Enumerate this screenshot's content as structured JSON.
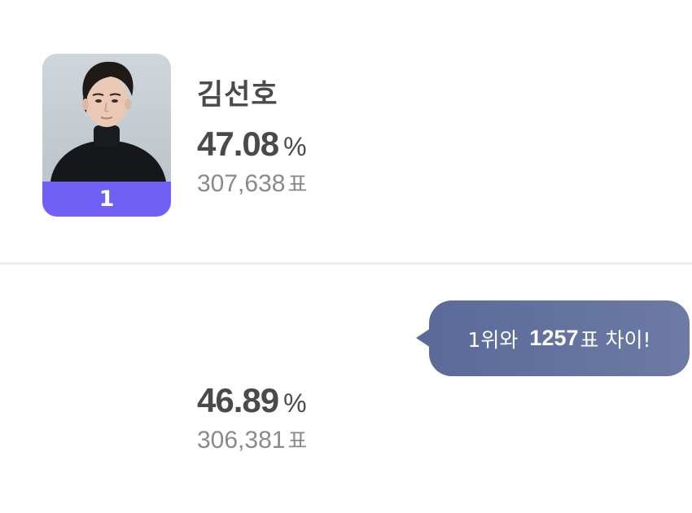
{
  "candidates": [
    {
      "rank": "1",
      "name": "김선호",
      "percent": "47.08",
      "percent_unit": "%",
      "votes": "307,638",
      "votes_unit": "표"
    },
    {
      "percent": "46.89",
      "percent_unit": "%",
      "votes": "306,381",
      "votes_unit": "표"
    }
  ],
  "gap_bubble": {
    "prefix": "1위와",
    "number": "1257",
    "suffix": "표 차이!"
  },
  "colors": {
    "rank_badge": "#7060f5",
    "bubble": "#5b6a99",
    "primary_text": "#4a4a4a",
    "secondary_text": "#8a8a8a",
    "divider": "#ececec"
  },
  "icons": {
    "candidate_photo": "portrait-photo"
  }
}
